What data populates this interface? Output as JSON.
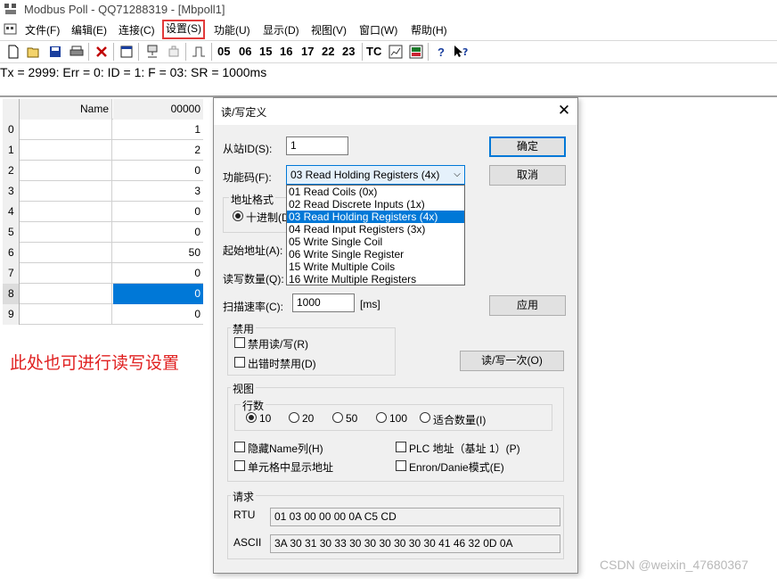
{
  "window": {
    "title": "Modbus Poll - QQ71288319 - [Mbpoll1]"
  },
  "menu": [
    {
      "label": "文件(F)"
    },
    {
      "label": "编辑(E)"
    },
    {
      "label": "连接(C)"
    },
    {
      "label": "设置(S)",
      "highlighted": true
    },
    {
      "label": "功能(U)"
    },
    {
      "label": "显示(D)"
    },
    {
      "label": "视图(V)"
    },
    {
      "label": "窗口(W)"
    },
    {
      "label": "帮助(H)"
    }
  ],
  "toolbar": {
    "codes": [
      "05",
      "06",
      "15",
      "16",
      "17",
      "22",
      "23",
      "TC"
    ],
    "icons": [
      "new-icon",
      "open-icon",
      "save-icon",
      "print-icon",
      "delete-icon",
      "window-icon",
      "connect-icon",
      "disconnect-icon",
      "pulse-icon",
      "chart-icon",
      "monitor-icon",
      "help-icon",
      "context-help-icon"
    ]
  },
  "status_line": "Tx = 2999: Err = 0: ID = 1: F = 03: SR = 1000ms",
  "grid": {
    "header": {
      "name": "Name",
      "value": "00000"
    },
    "rows": [
      {
        "index": "0",
        "value": "1"
      },
      {
        "index": "1",
        "value": "2"
      },
      {
        "index": "2",
        "value": "0"
      },
      {
        "index": "3",
        "value": "3"
      },
      {
        "index": "4",
        "value": "0"
      },
      {
        "index": "5",
        "value": "0"
      },
      {
        "index": "6",
        "value": "50"
      },
      {
        "index": "7",
        "value": "0"
      },
      {
        "index": "8",
        "value": "0",
        "selected": true
      },
      {
        "index": "9",
        "value": "0"
      }
    ]
  },
  "annotation": "此处也可进行读写设置",
  "dialog": {
    "title": "读/写定义",
    "slave_id_label": "从站ID(S):",
    "slave_id_value": "1",
    "function_label": "功能码(F):",
    "function_selected": "03 Read Holding Registers (4x)",
    "function_options": [
      "01 Read Coils (0x)",
      "02 Read Discrete Inputs (1x)",
      "03 Read Holding Registers (4x)",
      "04 Read Input Registers (3x)",
      "05 Write Single Coil",
      "06 Write Single Register",
      "15 Write Multiple Coils",
      "16 Write Multiple Registers"
    ],
    "address_format_label": "地址格式",
    "address_format_option": "十进制(D",
    "start_address_label": "起始地址(A):",
    "quantity_label": "读写数量(Q):",
    "scan_rate_label": "扫描速率(C):",
    "scan_rate_value": "1000",
    "scan_rate_unit": "[ms]",
    "ok_button": "确定",
    "cancel_button": "取消",
    "apply_button": "应用",
    "read_write_once_button": "读/写一次(O)",
    "disable_group": "禁用",
    "disable_rw": "禁用读/写(R)",
    "disable_on_error": "出错时禁用(D)",
    "view_group": "视图",
    "rows_group": "行数",
    "rows_options": [
      "10",
      "20",
      "50",
      "100",
      "适合数量(I)"
    ],
    "hide_name_column": "隐藏Name列(H)",
    "plc_address": "PLC 地址（基址 1）(P)",
    "show_address_in_cell": "单元格中显示地址",
    "enron_mode": "Enron/Danie模式(E)",
    "request_group": "请求",
    "rtu_label": "RTU",
    "rtu_value": "01 03 00 00 00 0A C5 CD",
    "ascii_label": "ASCII",
    "ascii_value": "3A 30 31 30 33 30 30 30 30 30 30 41 46 32 0D 0A"
  },
  "watermark": "CSDN @weixin_47680367"
}
